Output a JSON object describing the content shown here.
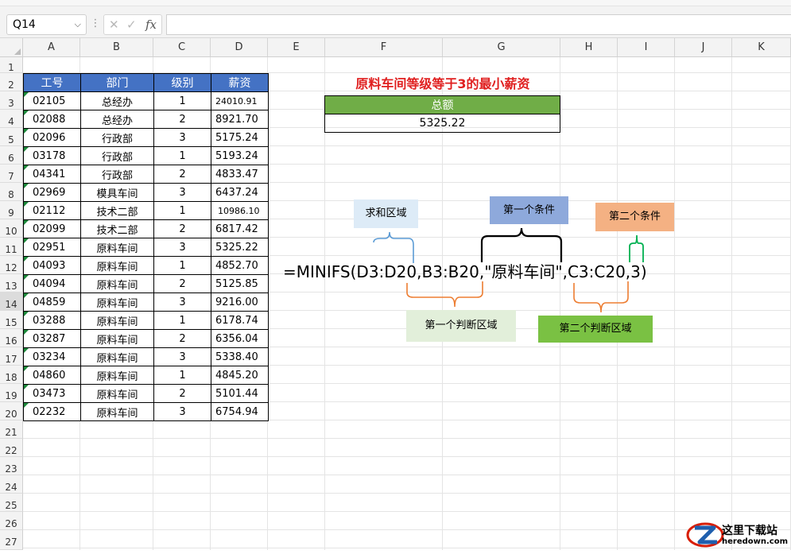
{
  "formula_bar": {
    "name_box": "Q14",
    "more_icon": "⋮",
    "cancel_icon": "✕",
    "enter_icon": "✓",
    "function_icon": "fx",
    "formula": ""
  },
  "columns": [
    "A",
    "B",
    "C",
    "D",
    "E",
    "F",
    "G",
    "H",
    "I",
    "J",
    "K"
  ],
  "rows": [
    "1",
    "2",
    "3",
    "4",
    "5",
    "6",
    "7",
    "8",
    "9",
    "10",
    "11",
    "12",
    "13",
    "14",
    "15",
    "16",
    "17",
    "18",
    "19",
    "20",
    "21",
    "22",
    "23",
    "24",
    "25",
    "26",
    "27"
  ],
  "selected_row": "14",
  "table": {
    "headers": [
      "工号",
      "部门",
      "级别",
      "薪资"
    ],
    "rows": [
      [
        "02105",
        "总经办",
        "1",
        "24010.91"
      ],
      [
        "02088",
        "总经办",
        "2",
        "8921.70"
      ],
      [
        "02096",
        "行政部",
        "3",
        "5175.24"
      ],
      [
        "03178",
        "行政部",
        "1",
        "5193.24"
      ],
      [
        "04341",
        "行政部",
        "2",
        "4833.47"
      ],
      [
        "02969",
        "模具车间",
        "3",
        "6437.24"
      ],
      [
        "02112",
        "技术二部",
        "1",
        "10986.10"
      ],
      [
        "02099",
        "技术二部",
        "2",
        "6817.42"
      ],
      [
        "02951",
        "原料车间",
        "3",
        "5325.22"
      ],
      [
        "04093",
        "原料车间",
        "1",
        "4852.70"
      ],
      [
        "04094",
        "原料车间",
        "2",
        "5125.85"
      ],
      [
        "04859",
        "原料车间",
        "3",
        "9216.00"
      ],
      [
        "03288",
        "原料车间",
        "1",
        "6178.74"
      ],
      [
        "03287",
        "原料车间",
        "2",
        "6356.04"
      ],
      [
        "03234",
        "原料车间",
        "3",
        "5338.40"
      ],
      [
        "04860",
        "原料车间",
        "1",
        "4845.20"
      ],
      [
        "03473",
        "原料车间",
        "2",
        "5101.44"
      ],
      [
        "02232",
        "原料车间",
        "3",
        "6754.94"
      ]
    ]
  },
  "result": {
    "title": "原料车间等级等于3的最小薪资",
    "header": "总额",
    "value": "5325.22"
  },
  "formula_text": "=MINIFS(D3:D20,B3:B20,\"原料车间\",C3:C20,3)",
  "annotations": {
    "sum_range": "求和区域",
    "criteria1": "第一个条件",
    "criteria2": "第二个条件",
    "criteria_range1": "第一个判断区域",
    "criteria_range2": "第二个判断区域"
  },
  "watermark": {
    "title": "这里下载站",
    "url": "heredown.com"
  },
  "colors": {
    "header_blue": "#4472c4",
    "result_green": "#70ad47",
    "title_red": "#e02020",
    "brace_blue": "#5b9bd5",
    "brace_orange": "#ed7d31",
    "brace_green": "#00b050",
    "watermark_red": "#d81e06",
    "watermark_blue": "#1f5fae"
  }
}
